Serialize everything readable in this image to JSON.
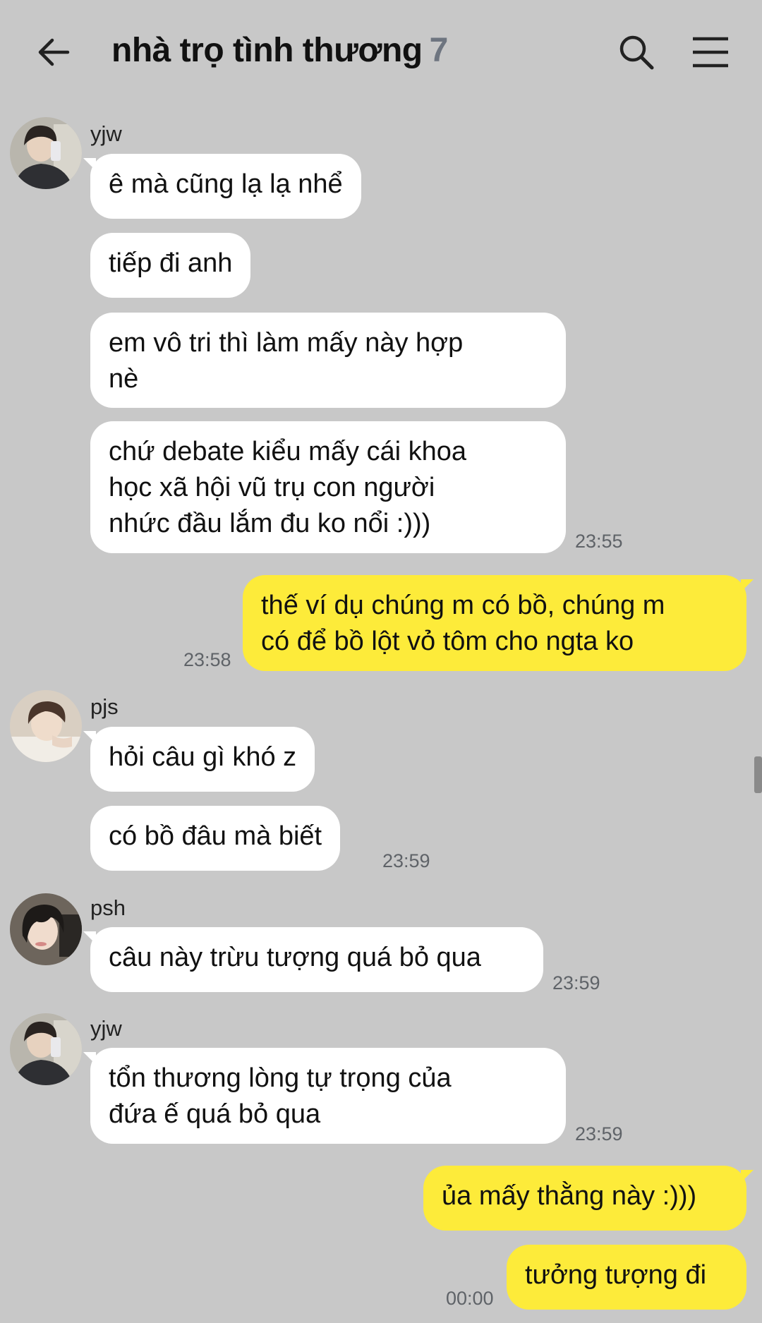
{
  "header": {
    "title": "nhà trọ tình thương",
    "member_count": "7",
    "icons": {
      "back": "arrow-left-icon",
      "search": "search-icon",
      "menu": "hamburger-menu-icon"
    }
  },
  "colors": {
    "background": "#c8c8c8",
    "incoming_bubble": "#ffffff",
    "outgoing_bubble": "#fdeb3a",
    "member_count": "#6e7580",
    "timestamp": "#5f6368"
  },
  "messages": [
    {
      "sender": "yjw",
      "text": "ê mà cũng lạ lạ nhể"
    },
    {
      "text": "tiếp đi anh"
    },
    {
      "text": "em vô tri thì làm mấy này hợp\nnè"
    },
    {
      "text": "chứ debate kiểu mấy cái khoa\nhọc xã hội vũ trụ con người\nnhức đầu lắm đu ko nổi :)))",
      "time": "23:55"
    },
    {
      "text": "thế ví dụ chúng m có bồ, chúng m\ncó để bồ lột vỏ tôm cho ngta ko",
      "time": "23:58"
    },
    {
      "sender": "pjs",
      "text": "hỏi câu gì khó z"
    },
    {
      "text": "có bồ đâu mà biết",
      "time": "23:59"
    },
    {
      "sender": "psh",
      "text": "câu này trừu tượng quá bỏ qua",
      "time": "23:59"
    },
    {
      "sender": "yjw",
      "text": "tổn thương lòng tự trọng của\nđứa ế quá bỏ qua",
      "time": "23:59"
    },
    {
      "text": "ủa mấy thằng này :)))"
    },
    {
      "text": "tưởng tượng đi",
      "time": "00:00"
    }
  ]
}
